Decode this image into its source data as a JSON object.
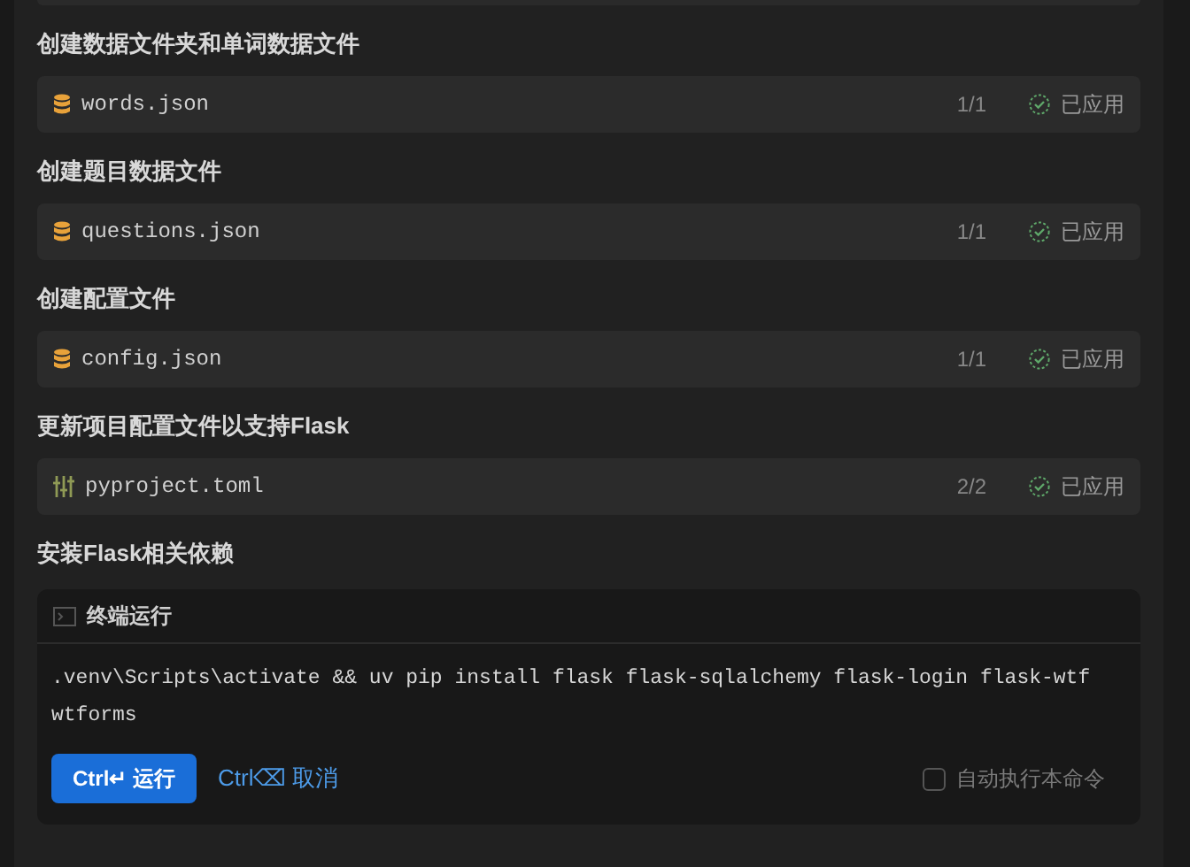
{
  "steps": [
    {
      "title": "创建数据文件夹和单词数据文件",
      "file": {
        "kind": "json",
        "name": "words.json",
        "count": "1/1",
        "status": "已应用",
        "applied": true
      }
    },
    {
      "title": "创建题目数据文件",
      "file": {
        "kind": "json",
        "name": "questions.json",
        "count": "1/1",
        "status": "已应用",
        "applied": true
      }
    },
    {
      "title": "创建配置文件",
      "file": {
        "kind": "json",
        "name": "config.json",
        "count": "1/1",
        "status": "已应用",
        "applied": true
      }
    },
    {
      "title": "更新项目配置文件以支持Flask",
      "file": {
        "kind": "toml",
        "name": "pyproject.toml",
        "count": "2/2",
        "status": "已应用",
        "applied": true
      }
    }
  ],
  "terminal": {
    "step_title": "安装Flask相关依赖",
    "header": "终端运行",
    "command": ".venv\\Scripts\\activate && uv pip install flask flask-sqlalchemy flask-login flask-wtf wtforms",
    "run_button": "Ctrl↵ 运行",
    "cancel_button": "Ctrl⌫ 取消",
    "auto_run": {
      "label": "自动执行本命令",
      "checked": false
    }
  }
}
